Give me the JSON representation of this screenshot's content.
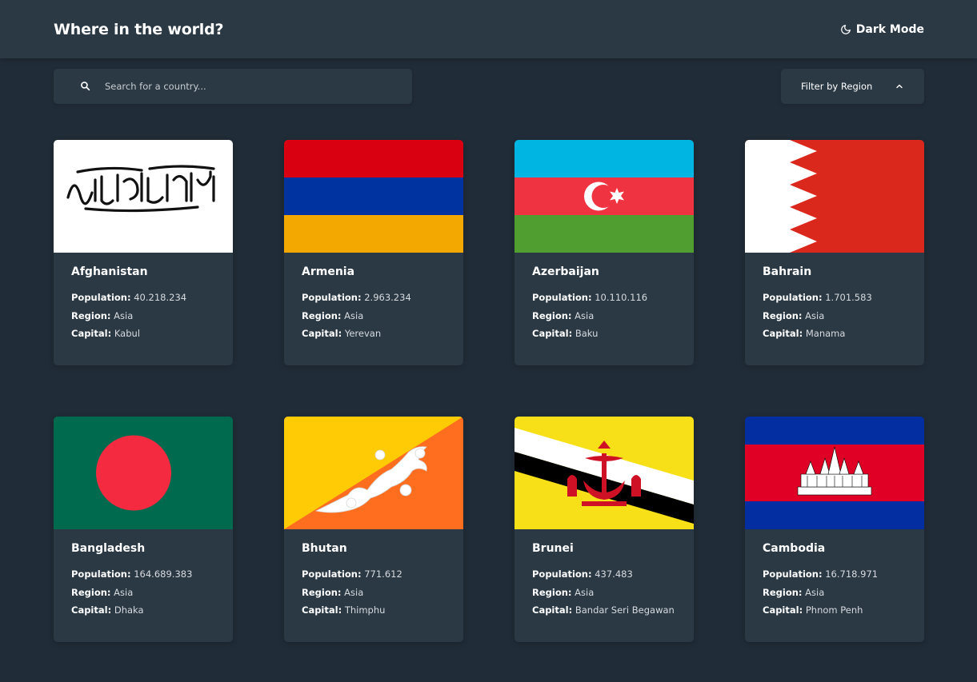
{
  "header": {
    "title": "Where in the world?",
    "mode_toggle_label": "Dark Mode",
    "mode_icon": "moon-icon"
  },
  "search": {
    "placeholder": "Search for a country...",
    "value": "",
    "icon": "search-icon"
  },
  "filter": {
    "label": "Filter by Region",
    "icon": "chevron-up-icon"
  },
  "field_labels": {
    "population": "Population:",
    "region": "Region:",
    "capital": "Capital:"
  },
  "countries": [
    {
      "name": "Afghanistan",
      "population": "40.218.234",
      "region": "Asia",
      "capital": "Kabul"
    },
    {
      "name": "Armenia",
      "population": "2.963.234",
      "region": "Asia",
      "capital": "Yerevan"
    },
    {
      "name": "Azerbaijan",
      "population": "10.110.116",
      "region": "Asia",
      "capital": "Baku"
    },
    {
      "name": "Bahrain",
      "population": "1.701.583",
      "region": "Asia",
      "capital": "Manama"
    },
    {
      "name": "Bangladesh",
      "population": "164.689.383",
      "region": "Asia",
      "capital": "Dhaka"
    },
    {
      "name": "Bhutan",
      "population": "771.612",
      "region": "Asia",
      "capital": "Thimphu"
    },
    {
      "name": "Brunei",
      "population": "437.483",
      "region": "Asia",
      "capital": "Bandar Seri Begawan"
    },
    {
      "name": "Cambodia",
      "population": "16.718.971",
      "region": "Asia",
      "capital": "Phnom Penh"
    }
  ],
  "colors": {
    "background": "#202c37",
    "element": "#2b3945",
    "text": "#ffffff"
  }
}
